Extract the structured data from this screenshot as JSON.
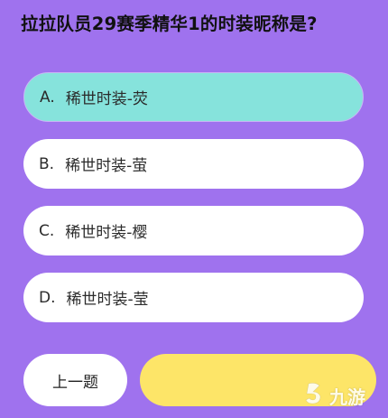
{
  "question": "拉拉队员29赛季精华1的时装昵称是?",
  "options": [
    {
      "letter": "A.",
      "text": "稀世时装-荧",
      "selected": true
    },
    {
      "letter": "B.",
      "text": "稀世时装-萤",
      "selected": false
    },
    {
      "letter": "C.",
      "text": "稀世时装-樱",
      "selected": false
    },
    {
      "letter": "D.",
      "text": "稀世时装-莹",
      "selected": false
    }
  ],
  "prev_label": "上一题",
  "next_label": "",
  "watermark": {
    "text": "九游",
    "icon": "jiuyou-logo-icon"
  },
  "colors": {
    "background": "#9f72ee",
    "selected_option": "#86e3dc",
    "option": "#ffffff",
    "next_button": "#fde568"
  }
}
